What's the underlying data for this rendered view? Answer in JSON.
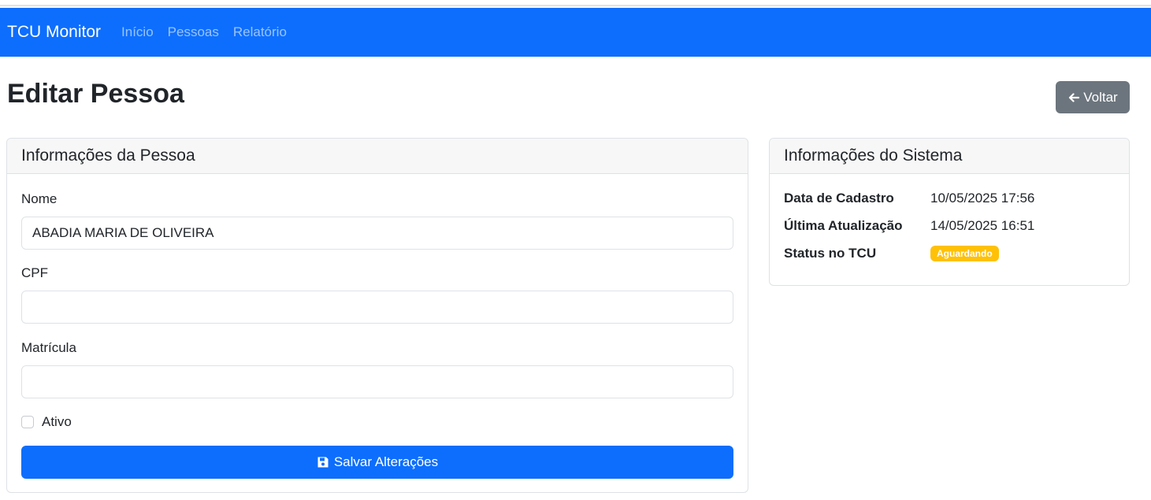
{
  "navbar": {
    "brand": "TCU Monitor",
    "links": [
      "Início",
      "Pessoas",
      "Relatório"
    ]
  },
  "page": {
    "title": "Editar Pessoa",
    "back_button": "Voltar"
  },
  "person_card": {
    "header": "Informações da Pessoa",
    "fields": {
      "nome": {
        "label": "Nome",
        "value": "ABADIA MARIA DE OLIVEIRA"
      },
      "cpf": {
        "label": "CPF",
        "value": ""
      },
      "matricula": {
        "label": "Matrícula",
        "value": ""
      }
    },
    "ativo_label": "Ativo",
    "ativo_checked": false,
    "save_button": "Salvar Alterações"
  },
  "system_card": {
    "header": "Informações do Sistema",
    "rows": [
      {
        "key": "Data de Cadastro",
        "value": "10/05/2025 17:56"
      },
      {
        "key": "Última Atualização",
        "value": "14/05/2025 16:51"
      },
      {
        "key": "Status no TCU",
        "badge": "Aguardando"
      }
    ]
  },
  "colors": {
    "primary": "#0d6efd",
    "secondary": "#6c757d",
    "warning": "#ffc107"
  }
}
